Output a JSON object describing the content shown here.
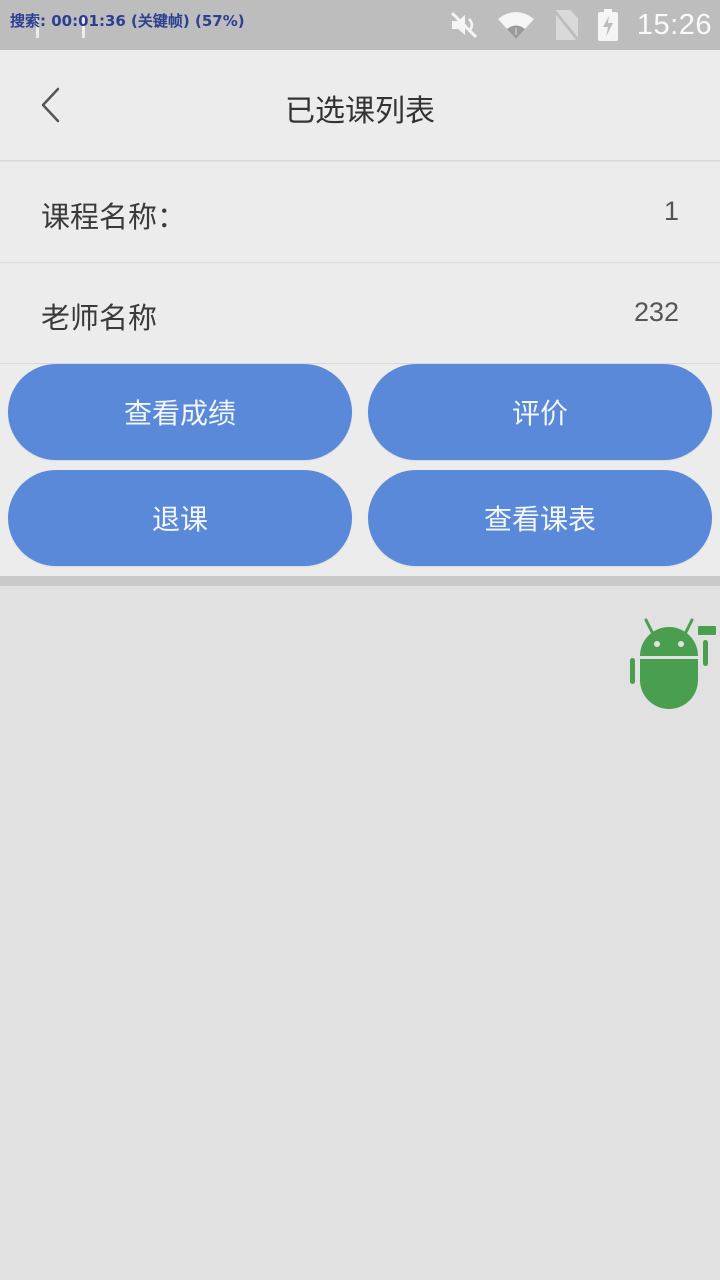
{
  "status_bar": {
    "overlay_text": "搜索: 00:01:36 (关键帧) (57%)",
    "time": "15:26",
    "icons": [
      "muted-speaker-icon",
      "wifi-icon",
      "no-sim-icon",
      "battery-charging-icon"
    ]
  },
  "header": {
    "title": "已选课列表",
    "back_icon": "chevron-left-icon"
  },
  "rows": [
    {
      "label": "课程名称：",
      "value": "1"
    },
    {
      "label": "老师名称",
      "value": "232"
    }
  ],
  "actions": {
    "view_grades": "查看成绩",
    "evaluate": "评价",
    "drop_course": "退课",
    "view_schedule": "查看课表"
  },
  "colors": {
    "button": "#5989d8",
    "background": "#e1e1e1",
    "panel": "#ececec",
    "status_bar": "#bdbdbd",
    "mascot": "#4a9e4f"
  },
  "floating_icon": "android-mascot-icon"
}
